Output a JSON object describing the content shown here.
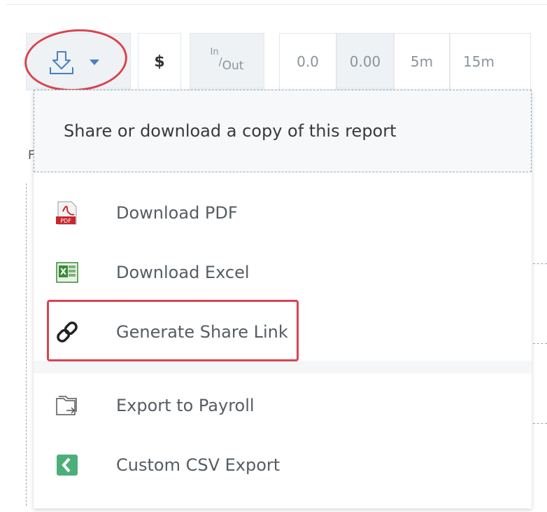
{
  "toolbar": {
    "download_button": {
      "icon": "download-icon",
      "caret": "chevron-down-icon"
    },
    "dollar_label": "$",
    "inout_label": {
      "sup": "In",
      "slash": "/",
      "sub": "Out"
    },
    "decimal_one": "0.0",
    "decimal_two": "0.00",
    "interval_5m": "5m",
    "interval_15m": "15m"
  },
  "dropdown": {
    "header": "Share or download a copy of this report",
    "items": [
      {
        "label": "Download PDF",
        "icon": "pdf-icon"
      },
      {
        "label": "Download Excel",
        "icon": "excel-icon"
      },
      {
        "label": "Generate Share Link",
        "icon": "link-icon"
      },
      {
        "label": "Export to Payroll",
        "icon": "folder-export-icon"
      },
      {
        "label": "Custom CSV Export",
        "icon": "csv-export-icon"
      }
    ]
  },
  "background": {
    "partial_letter": "F"
  },
  "colors": {
    "annotation_red": "#d9434f",
    "accent_blue": "#4a7cc4",
    "pdf_red": "#c9252c",
    "excel_green": "#3a8a3a"
  }
}
